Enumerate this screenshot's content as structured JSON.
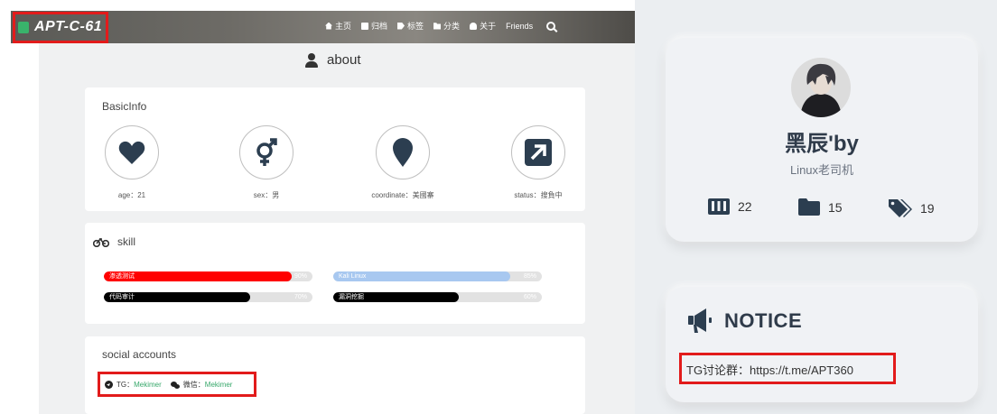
{
  "navbar": {
    "brand": "APT-C-61",
    "menu": [
      {
        "icon": "home-icon",
        "label": "主页"
      },
      {
        "icon": "archive-icon",
        "label": "归档"
      },
      {
        "icon": "tag-icon",
        "label": "标签"
      },
      {
        "icon": "category-icon",
        "label": "分类"
      },
      {
        "icon": "user-icon",
        "label": "关于"
      },
      {
        "icon": "",
        "label": "Friends"
      }
    ]
  },
  "page": {
    "title": "about"
  },
  "basic_info": {
    "title": "BasicInfo",
    "items": [
      {
        "icon": "heart-icon",
        "label": "age：21"
      },
      {
        "icon": "gender-icon",
        "label": "sex：男"
      },
      {
        "icon": "map-marker-icon",
        "label": "coordinate：美國寨"
      },
      {
        "icon": "external-link-icon",
        "label": "status：搜負中"
      }
    ]
  },
  "skill": {
    "title": "skill",
    "bars": [
      {
        "name": "渗透测试",
        "percent": "90%",
        "value": 0.9,
        "color": "#ff0000"
      },
      {
        "name": "Kali Linux",
        "percent": "85%",
        "value": 0.85,
        "color": "#a8c8f0"
      },
      {
        "name": "代码审计",
        "percent": "70%",
        "value": 0.7,
        "color": "#000000"
      },
      {
        "name": "漏洞挖掘",
        "percent": "60%",
        "value": 0.6,
        "color": "#000000"
      }
    ]
  },
  "social": {
    "title": "social accounts",
    "tg_label": "TG：",
    "tg_value": "Mekimer",
    "wechat_label": "微信：",
    "wechat_value": "Mekimer"
  },
  "profile": {
    "name": "黑辰'by",
    "desc": "Linux老司机",
    "stats": [
      {
        "icon": "book-icon",
        "count": "22"
      },
      {
        "icon": "folder-icon",
        "count": "15"
      },
      {
        "icon": "tags-icon",
        "count": "19"
      }
    ]
  },
  "notice": {
    "title": "NOTICE",
    "text": "TG讨论群：https://t.me/APT360"
  },
  "colors": {
    "highlight_box": "#e21b1b",
    "link": "#38a86b",
    "brand_logo": "#39b36b"
  }
}
